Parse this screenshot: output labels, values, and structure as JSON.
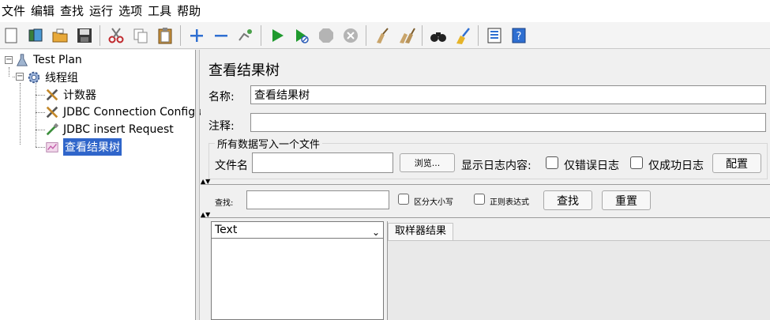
{
  "menu": [
    "文件",
    "编辑",
    "查找",
    "运行",
    "选项",
    "工具",
    "帮助"
  ],
  "toolbar": {
    "icons": [
      "new-icon",
      "templates-icon",
      "open-icon",
      "save-icon",
      "cut-icon",
      "copy-icon",
      "paste-icon",
      "expand-icon",
      "collapse-icon",
      "toggle-icon",
      "start-icon",
      "start-no-pause-icon",
      "stop-icon",
      "shutdown-icon",
      "clear-icon",
      "clear-all-icon",
      "search-icon",
      "reset-search-icon",
      "function-helper-icon",
      "help-icon"
    ]
  },
  "tree": {
    "items": [
      {
        "label": "Test Plan",
        "icon": "test-plan-icon"
      },
      {
        "label": "线程组",
        "icon": "thread-group-icon"
      },
      {
        "label": "计数器",
        "icon": "counter-icon"
      },
      {
        "label": "JDBC Connection Configura",
        "icon": "jdbc-config-icon"
      },
      {
        "label": "JDBC insert Request",
        "icon": "jdbc-request-icon"
      },
      {
        "label": "查看结果树",
        "icon": "results-tree-icon"
      }
    ]
  },
  "panel": {
    "title": "查看结果树",
    "name_label": "名称:",
    "name_value": "查看结果树",
    "comment_label": "注释:",
    "comment_value": "",
    "file_group_title": "所有数据写入一个文件",
    "filename_label": "文件名",
    "filename_value": "",
    "browse_label": "浏览...",
    "log_content_label": "显示日志内容:",
    "errors_only_label": "仅错误日志",
    "success_only_label": "仅成功日志",
    "configure_label": "配置",
    "search_label": "查找:",
    "search_value": "",
    "case_sensitive_label": "区分大小写",
    "regex_label": "正则表达式",
    "find_label": "查找",
    "reset_label": "重置",
    "renderer_selected": "Text",
    "sampler_tab_label": "取样器结果"
  }
}
